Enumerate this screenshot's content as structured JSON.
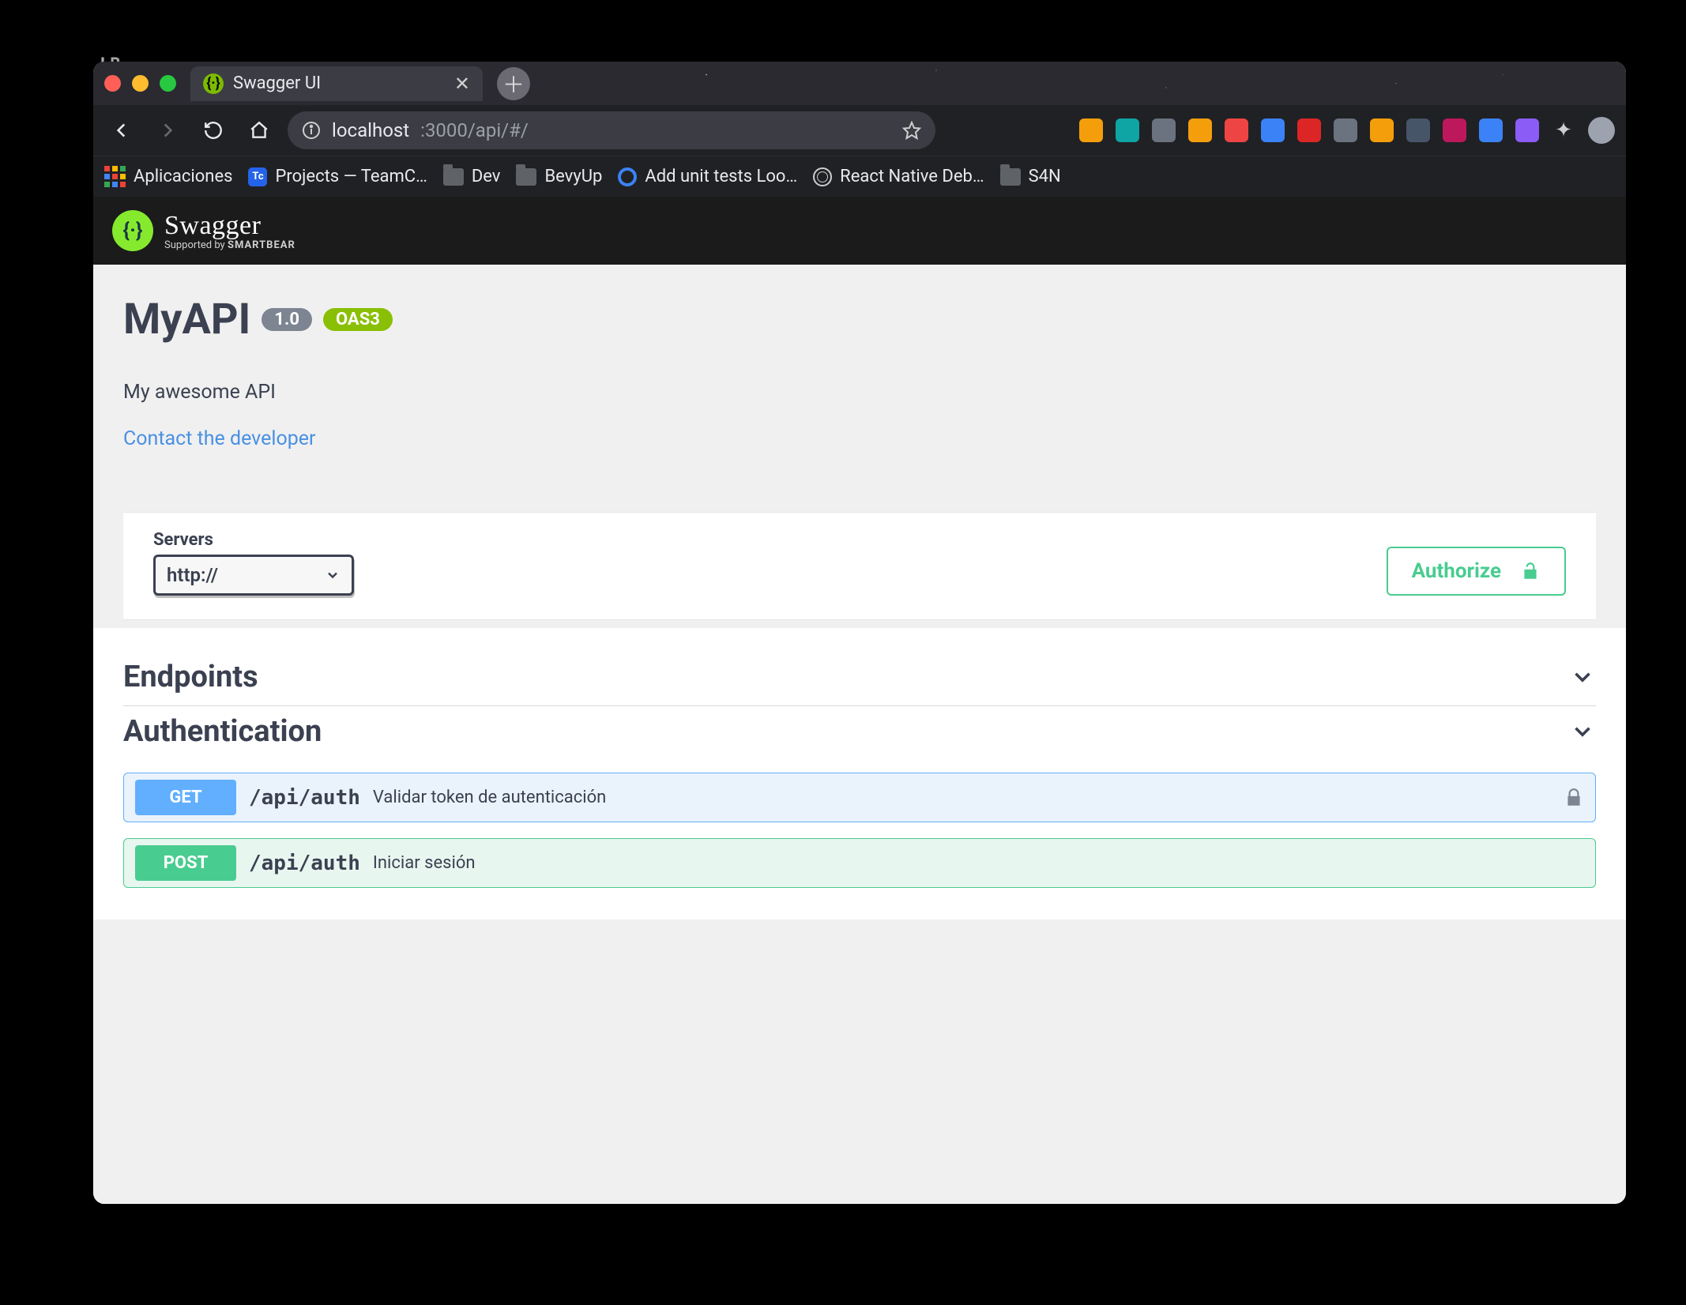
{
  "browser": {
    "tab_title": "Swagger UI",
    "url_host": "localhost",
    "url_port_path": ":3000/api/#/",
    "bookmarks": {
      "apps": "Aplicaciones",
      "projects": "Projects — TeamC…",
      "dev": "Dev",
      "bevyup": "BevyUp",
      "add_unit": "Add unit tests Loo…",
      "rn_debug": "React Native Deb…",
      "s4n": "S4N"
    }
  },
  "swagger": {
    "brand_line1": "Swagger",
    "brand_line2_prefix": "Supported by ",
    "brand_line2_bold": "SMARTBEAR",
    "title": "MyAPI",
    "version": "1.0",
    "oas_badge": "OAS3",
    "description": "My awesome API",
    "contact_link": "Contact the developer",
    "servers_label": "Servers",
    "server_selected": "http://",
    "authorize": "Authorize",
    "tags": {
      "endpoints": "Endpoints",
      "authentication": "Authentication"
    },
    "ops": [
      {
        "method": "GET",
        "path": "/api/auth",
        "summary": "Validar token de autenticación",
        "locked": true
      },
      {
        "method": "POST",
        "path": "/api/auth",
        "summary": "Iniciar sesión",
        "locked": false
      }
    ]
  }
}
